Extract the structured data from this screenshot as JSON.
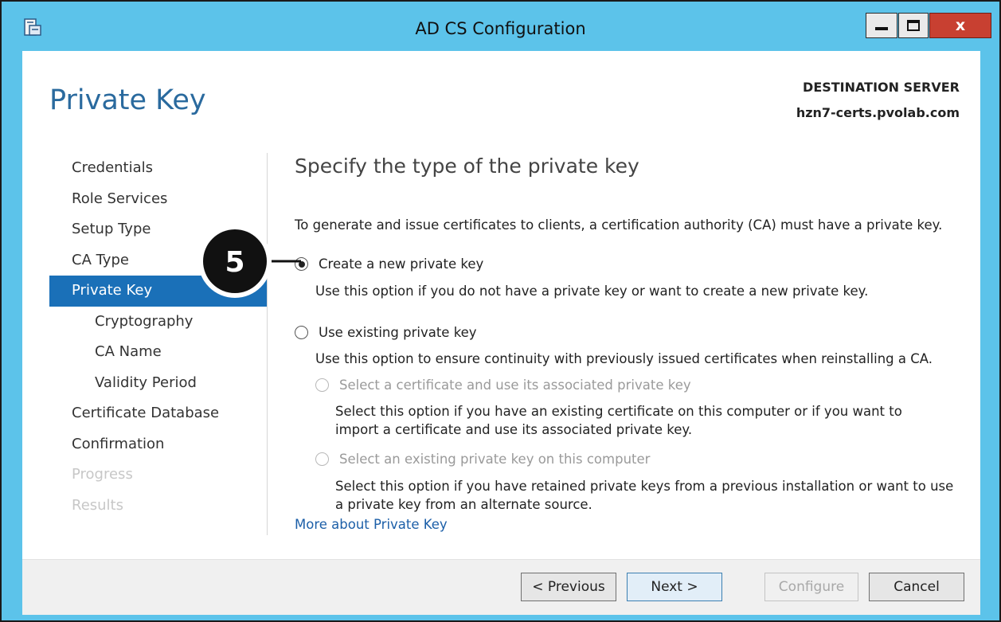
{
  "window": {
    "title": "AD CS Configuration",
    "close_glyph": "x",
    "accent": "#5cc3ea",
    "close_color": "#c84031"
  },
  "header": {
    "page_title": "Private Key",
    "dest_label": "DESTINATION SERVER",
    "dest_server": "hzn7-certs.pvolab.com"
  },
  "nav": {
    "items": [
      {
        "label": "Credentials",
        "state": "normal"
      },
      {
        "label": "Role Services",
        "state": "normal"
      },
      {
        "label": "Setup Type",
        "state": "normal"
      },
      {
        "label": "CA Type",
        "state": "normal"
      },
      {
        "label": "Private Key",
        "state": "active"
      },
      {
        "label": "Cryptography",
        "state": "sub"
      },
      {
        "label": "CA Name",
        "state": "sub"
      },
      {
        "label": "Validity Period",
        "state": "sub"
      },
      {
        "label": "Certificate Database",
        "state": "normal"
      },
      {
        "label": "Confirmation",
        "state": "normal"
      },
      {
        "label": "Progress",
        "state": "disabled"
      },
      {
        "label": "Results",
        "state": "disabled"
      }
    ]
  },
  "content": {
    "heading": "Specify the type of the private key",
    "intro": "To generate and issue certificates to clients, a certification authority (CA) must have a private key.",
    "option_new": {
      "label": "Create a new private key",
      "desc": "Use this option if you do not have a private key or want to create a new private key.",
      "selected": true
    },
    "option_existing": {
      "label": "Use existing private key",
      "desc": "Use this option to ensure continuity with previously issued certificates when reinstalling a CA.",
      "selected": false
    },
    "sub_cert": {
      "label": "Select a certificate and use its associated private key",
      "desc": "Select this option if you have an existing certificate on this computer or if you want to import a certificate and use its associated private key."
    },
    "sub_key": {
      "label": "Select an existing private key on this computer",
      "desc": "Select this option if you have retained private keys from a previous installation or want to use a private key from an alternate source."
    },
    "link": "More about Private Key"
  },
  "footer": {
    "previous": "< Previous",
    "next": "Next >",
    "configure": "Configure",
    "cancel": "Cancel"
  },
  "callout": {
    "number": "5"
  },
  "icons": [
    "app-icon",
    "minimize-icon",
    "maximize-icon",
    "close-icon",
    "callout-arrow-icon"
  ]
}
